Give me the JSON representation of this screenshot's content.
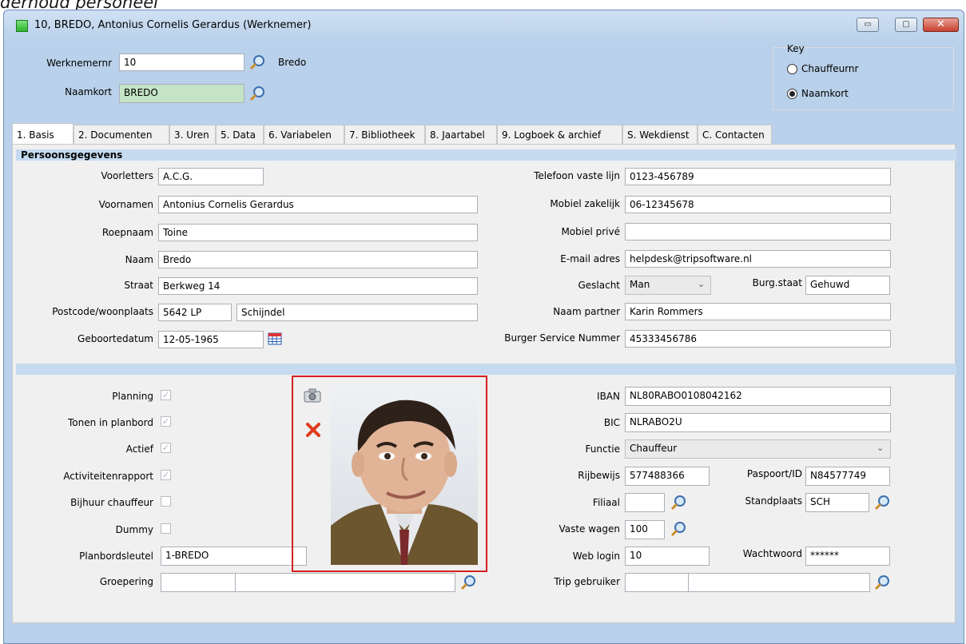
{
  "doc_title": "derhoud personeel",
  "window": {
    "title": "10, BREDO, Antonius Cornelis Gerardus (Werknemer)",
    "min_label": "▭",
    "max_label": "▢",
    "close_label": "✕"
  },
  "header": {
    "werknemernr_label": "Werknemernr",
    "werknemernr_value": "10",
    "werknemernr_name": "Bredo",
    "naamkort_label": "Naamkort",
    "naamkort_value": "BREDO"
  },
  "key": {
    "title": "Key",
    "options": [
      "Chauffeurnr",
      "Naamkort"
    ],
    "selected": "Naamkort"
  },
  "tabs": [
    "1. Basis",
    "2. Documenten",
    "3. Uren",
    "5. Data",
    "6. Variabelen",
    "7. Bibliotheek",
    "8. Jaartabel",
    "9. Logboek & archief",
    "S. Wekdienst",
    "C. Contacten"
  ],
  "active_tab": "1. Basis",
  "section_title": "Persoonsgegevens",
  "left_fields": {
    "voorletters": {
      "label": "Voorletters",
      "value": "A.C.G."
    },
    "voornamen": {
      "label": "Voornamen",
      "value": "Antonius Cornelis Gerardus"
    },
    "roepnaam": {
      "label": "Roepnaam",
      "value": "Toine"
    },
    "naam": {
      "label": "Naam",
      "value": "Bredo"
    },
    "straat": {
      "label": "Straat",
      "value": "Berkweg 14"
    },
    "postcode": {
      "label": "Postcode/woonplaats",
      "postcode": "5642 LP",
      "woonplaats": "Schijndel"
    },
    "geboortedatum": {
      "label": "Geboortedatum",
      "value": "12-05-1965"
    }
  },
  "right_fields": {
    "telefoon": {
      "label": "Telefoon vaste lijn",
      "value": "0123-456789"
    },
    "mobiel_zakelijk": {
      "label": "Mobiel zakelijk",
      "value": "06-12345678"
    },
    "mobiel_prive": {
      "label": "Mobiel privé",
      "value": ""
    },
    "email": {
      "label": "E-mail adres",
      "value": "helpdesk@tripsoftware.nl"
    },
    "geslacht": {
      "label": "Geslacht",
      "value": "Man"
    },
    "burgstaat": {
      "label": "Burg.staat",
      "value": "Gehuwd"
    },
    "partner": {
      "label": "Naam partner",
      "value": "Karin Rommers"
    },
    "bsn": {
      "label": "Burger Service Nummer",
      "value": "45333456786"
    }
  },
  "checkboxes": [
    {
      "label": "Planning",
      "checked": true
    },
    {
      "label": "Tonen in planbord",
      "checked": true
    },
    {
      "label": "Actief",
      "checked": true
    },
    {
      "label": "Activiteitenrapport",
      "checked": true
    },
    {
      "label": "Bijhuur chauffeur",
      "checked": false
    },
    {
      "label": "Dummy",
      "checked": false
    }
  ],
  "planbordsleutel": {
    "label": "Planbordsleutel",
    "value": "1-BREDO"
  },
  "groepering": {
    "label": "Groepering",
    "value1": "",
    "value2": ""
  },
  "bottom_right": {
    "iban": {
      "label": "IBAN",
      "value": "NL80RABO0108042162"
    },
    "bic": {
      "label": "BIC",
      "value": "NLRABO2U"
    },
    "functie": {
      "label": "Functie",
      "value": "Chauffeur"
    },
    "rijbewijs": {
      "label": "Rijbewijs",
      "value": "577488366"
    },
    "paspoort": {
      "label": "Paspoort/ID",
      "value": "N84577749"
    },
    "filiaal": {
      "label": "Filiaal",
      "value": ""
    },
    "standplaats": {
      "label": "Standplaats",
      "value": "SCH"
    },
    "vaste_wagen": {
      "label": "Vaste wagen",
      "value": "100"
    },
    "web_login": {
      "label": "Web login",
      "value": "10"
    },
    "wachtwoord": {
      "label": "Wachtwoord",
      "value": "******"
    },
    "trip_gebruiker": {
      "label": "Trip gebruiker",
      "value1": "",
      "value2": ""
    }
  },
  "colors": {
    "highlight_frame": "#d61f1f",
    "section_bar": "#c6dbf0",
    "naamkort_bg": "#c5e3c5"
  }
}
